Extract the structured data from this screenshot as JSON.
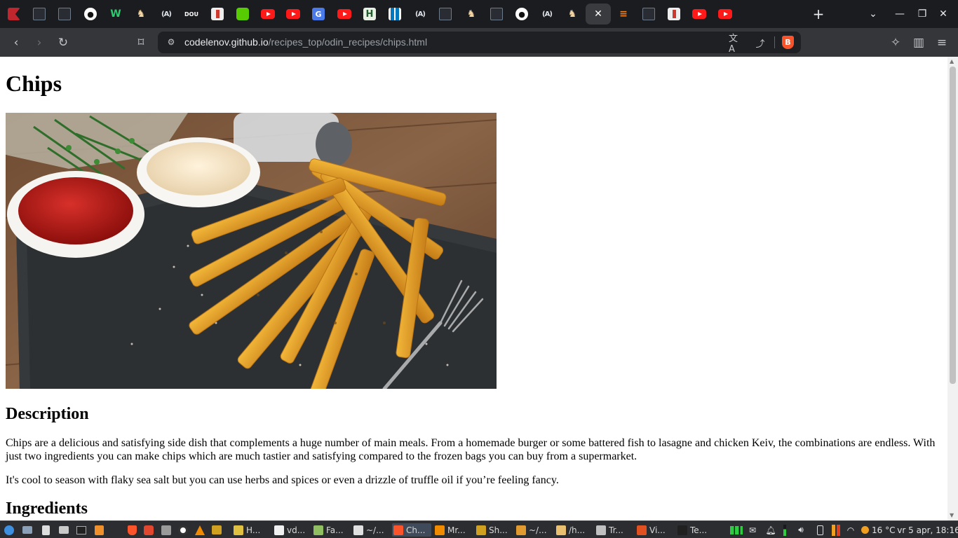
{
  "tabs": [
    {
      "icon": "flag-favicon"
    },
    {
      "icon": "terminal-favicon"
    },
    {
      "icon": "terminal-favicon"
    },
    {
      "icon": "github-favicon"
    },
    {
      "icon": "wttj-favicon"
    },
    {
      "icon": "odin-project-favicon"
    },
    {
      "icon": "a11y-favicon"
    },
    {
      "icon": "dou-favicon"
    },
    {
      "icon": "image-favicon"
    },
    {
      "icon": "duolingo-favicon"
    },
    {
      "icon": "youtube-favicon"
    },
    {
      "icon": "youtube-favicon"
    },
    {
      "icon": "google-translate-favicon"
    },
    {
      "icon": "youtube-favicon"
    },
    {
      "icon": "hh-favicon"
    },
    {
      "icon": "trello-favicon"
    },
    {
      "icon": "a11y-favicon"
    },
    {
      "icon": "terminal-favicon"
    },
    {
      "icon": "odin-project-favicon"
    },
    {
      "icon": "terminal-favicon"
    },
    {
      "icon": "github-favicon"
    },
    {
      "icon": "a11y-favicon"
    },
    {
      "icon": "odin-project-favicon"
    },
    {
      "icon": "close-icon",
      "active": true
    },
    {
      "icon": "stackoverflow-favicon"
    },
    {
      "icon": "terminal-favicon"
    },
    {
      "icon": "image-favicon"
    },
    {
      "icon": "youtube-favicon"
    },
    {
      "icon": "youtube-favicon"
    }
  ],
  "tab_glyphs": {
    "github": "●",
    "wttj": "W",
    "odin": "♞",
    "a11y": "(A)",
    "dou": "DOU",
    "gt": "G",
    "hh": "H",
    "so": "≡",
    "close": "✕",
    "newtab": "+"
  },
  "window_controls": {
    "tab_search": "⌄",
    "minimize": "—",
    "restore": "❐",
    "close": "✕"
  },
  "toolbar": {
    "back": "‹",
    "forward": "›",
    "reload": "↻",
    "bookmark": "⌑",
    "site_info": "⚙",
    "translate": "文A",
    "share": "⤴",
    "brave": "B",
    "extensions": "✧",
    "sidebar": "▥",
    "menu": "≡"
  },
  "address_bar": {
    "host": "codelenov.github.io",
    "path": "/recipes_top/odin_recipes/chips.html"
  },
  "page": {
    "title": "Chips",
    "description_heading": "Description",
    "paragraph1": "Chips are a delicious and satisfying side dish that complements a huge number of main meals. From a homemade burger or some battered fish to lasagne and chicken Keiv, the combinations are endless. With just two ingredients you can make chips which are much tastier and satisfying compared to the frozen bags you can buy from a supermarket.",
    "paragraph2": "It's cool to season with flaky sea salt but you can use herbs and spices or even a drizzle of truffle oil if you’re feeling fancy.",
    "ingredients_heading": "Ingredients"
  },
  "taskbar": {
    "items": [
      {
        "label": "H...",
        "icon_color": "#e0c040"
      },
      {
        "label": "vd...",
        "icon_color": "#f0f0f0"
      },
      {
        "label": "Fa...",
        "icon_color": "#8fbf60"
      },
      {
        "label": "~/...",
        "icon_color": "#e0e0e0"
      },
      {
        "label": "Ch...",
        "icon_color": "#fb542b",
        "active": true
      },
      {
        "label": "Mr...",
        "icon_color": "#f08a00"
      },
      {
        "label": "Sh...",
        "icon_color": "#d0a020"
      },
      {
        "label": "~/...",
        "icon_color": "#e09a30"
      },
      {
        "label": "/h...",
        "icon_color": "#e8c070"
      },
      {
        "label": "Tr...",
        "icon_color": "#c0c0c0"
      },
      {
        "label": "Vi...",
        "icon_color": "#e05020"
      },
      {
        "label": "Te...",
        "icon_color": "#202020"
      }
    ],
    "weather": "16 °C",
    "datetime": "vr  5 apr, 18:16"
  },
  "colors": {
    "brave_orange": "#fb542b",
    "tab_bar": "#1b1c1f",
    "toolbar": "#35363a",
    "omnibox": "#1f2023"
  }
}
